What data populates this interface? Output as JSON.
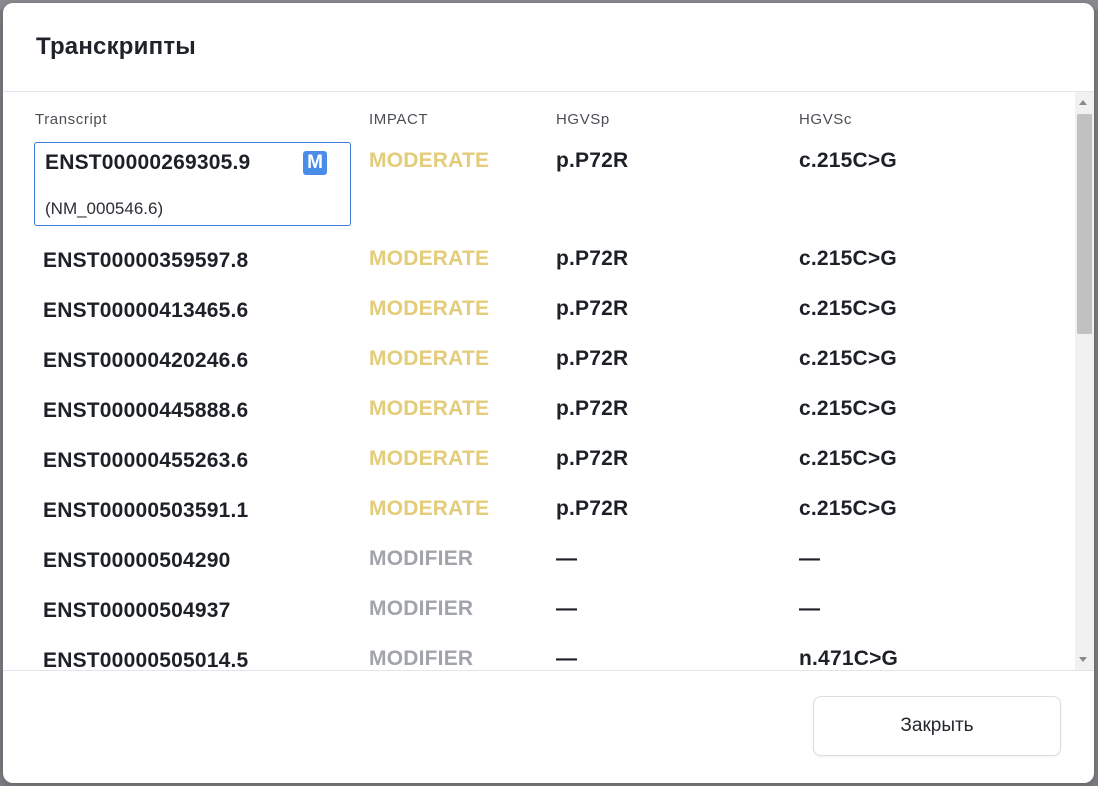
{
  "modal": {
    "title": "Транскрипты",
    "close_label": "Закрыть"
  },
  "table": {
    "headers": {
      "transcript": "Transcript",
      "impact": "IMPACT",
      "hgvsp": "HGVSp",
      "hgvsc": "HGVSc"
    },
    "selected": {
      "transcript": "ENST00000269305.9",
      "badge": "M",
      "refseq": "(NM_000546.6)",
      "impact": "MODERATE",
      "hgvsp": "p.P72R",
      "hgvsc": "c.215C>G"
    },
    "rows": [
      {
        "transcript": "ENST00000359597.8",
        "impact": "MODERATE",
        "hgvsp": "p.P72R",
        "hgvsc": "c.215C>G"
      },
      {
        "transcript": "ENST00000413465.6",
        "impact": "MODERATE",
        "hgvsp": "p.P72R",
        "hgvsc": "c.215C>G"
      },
      {
        "transcript": "ENST00000420246.6",
        "impact": "MODERATE",
        "hgvsp": "p.P72R",
        "hgvsc": "c.215C>G"
      },
      {
        "transcript": "ENST00000445888.6",
        "impact": "MODERATE",
        "hgvsp": "p.P72R",
        "hgvsc": "c.215C>G"
      },
      {
        "transcript": "ENST00000455263.6",
        "impact": "MODERATE",
        "hgvsp": "p.P72R",
        "hgvsc": "c.215C>G"
      },
      {
        "transcript": "ENST00000503591.1",
        "impact": "MODERATE",
        "hgvsp": "p.P72R",
        "hgvsc": "c.215C>G"
      },
      {
        "transcript": "ENST00000504290",
        "impact": "MODIFIER",
        "hgvsp": "—",
        "hgvsc": "—"
      },
      {
        "transcript": "ENST00000504937",
        "impact": "MODIFIER",
        "hgvsp": "—",
        "hgvsc": "—"
      },
      {
        "transcript": "ENST00000505014.5",
        "impact": "MODIFIER",
        "hgvsp": "—",
        "hgvsc": "n.471C>G"
      }
    ]
  },
  "colors": {
    "moderate": "#e3cc7a",
    "modifier": "#a2a4ab",
    "accent": "#3d7bd9"
  }
}
